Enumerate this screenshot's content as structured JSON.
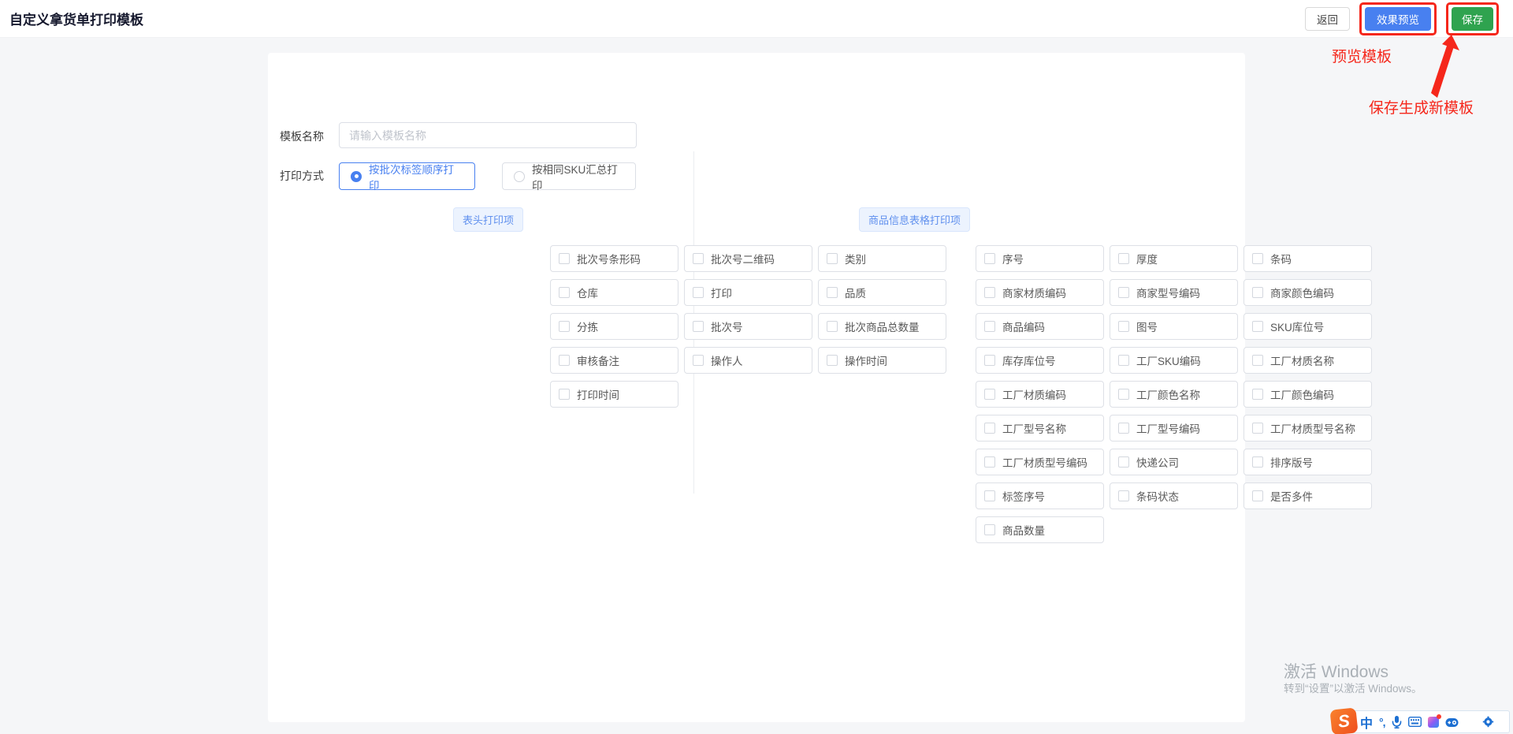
{
  "page": {
    "title": "自定义拿货单打印模板"
  },
  "toolbar": {
    "back_label": "返回",
    "preview_label": "效果预览",
    "save_label": "保存"
  },
  "annotations": {
    "preview_note": "预览模板",
    "save_note": "保存生成新模板",
    "highlight_color": "#f5271b"
  },
  "form": {
    "template_name": {
      "label": "模板名称",
      "value": "",
      "placeholder": "请输入模板名称"
    },
    "print_method": {
      "label": "打印方式",
      "options": [
        {
          "label": "按批次标签顺序打印",
          "selected": true
        },
        {
          "label": "按相同SKU汇总打印",
          "selected": false
        }
      ]
    }
  },
  "sections": {
    "header": {
      "title": "表头打印项",
      "items": [
        "批次号条形码",
        "批次号二维码",
        "类别",
        "仓库",
        "打印",
        "品质",
        "分拣",
        "批次号",
        "批次商品总数量",
        "审核备注",
        "操作人",
        "操作时间",
        "打印时间"
      ]
    },
    "product": {
      "title": "商品信息表格打印项",
      "items": [
        "序号",
        "厚度",
        "条码",
        "商家材质编码",
        "商家型号编码",
        "商家颜色编码",
        "商品编码",
        "图号",
        "SKU库位号",
        "库存库位号",
        "工厂SKU编码",
        "工厂材质名称",
        "工厂材质编码",
        "工厂颜色名称",
        "工厂颜色编码",
        "工厂型号名称",
        "工厂型号编码",
        "工厂材质型号名称",
        "工厂材质型号编码",
        "快递公司",
        "排序版号",
        "标签序号",
        "条码状态",
        "是否多件",
        "商品数量"
      ]
    }
  },
  "watermark": {
    "line1": "激活 Windows",
    "line2": "转到“设置”以激活 Windows。"
  },
  "ime_bar": {
    "logo": "S",
    "mode": "中",
    "punctuation": "°,",
    "icons": [
      "sogou-logo",
      "chinese-mode",
      "punctuation",
      "microphone",
      "keyboard",
      "skin",
      "robot",
      "toolbox",
      "settings"
    ]
  },
  "colors": {
    "accent_blue": "#4880f0",
    "save_green": "#2fa34f",
    "annotation_red": "#f5271b",
    "pill_bg": "#ecf3fe",
    "page_bg": "#f5f6f8"
  }
}
